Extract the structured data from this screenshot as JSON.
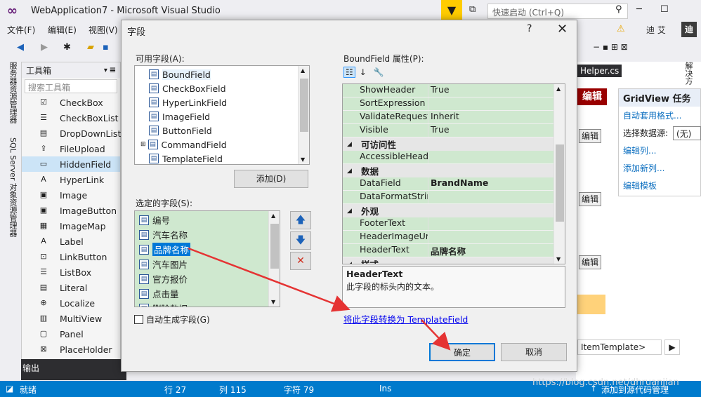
{
  "window": {
    "title": "WebApplication7 - Microsoft Visual Studio",
    "quick_launch": "快速启动 (Ctrl+Q)",
    "user": "迪 艾",
    "user_badge": "迪"
  },
  "menu": [
    "文件(F)",
    "编辑(E)",
    "视图(V)"
  ],
  "left_tabs": [
    "服务器资源管理器",
    "SQL Server 对象资源管理器"
  ],
  "toolbox": {
    "title": "工具箱",
    "search_placeholder": "搜索工具箱",
    "items": [
      {
        "label": "CheckBox",
        "icon": "checkbox-icon"
      },
      {
        "label": "CheckBoxList",
        "icon": "checkboxlist-icon"
      },
      {
        "label": "DropDownList",
        "icon": "dropdown-icon"
      },
      {
        "label": "FileUpload",
        "icon": "fileupload-icon"
      },
      {
        "label": "HiddenField",
        "icon": "hiddenfield-icon"
      },
      {
        "label": "HyperLink",
        "icon": "hyperlink-icon"
      },
      {
        "label": "Image",
        "icon": "image-icon"
      },
      {
        "label": "ImageButton",
        "icon": "imagebutton-icon"
      },
      {
        "label": "ImageMap",
        "icon": "imagemap-icon"
      },
      {
        "label": "Label",
        "icon": "label-icon"
      },
      {
        "label": "LinkButton",
        "icon": "linkbutton-icon"
      },
      {
        "label": "ListBox",
        "icon": "listbox-icon"
      },
      {
        "label": "Literal",
        "icon": "literal-icon"
      },
      {
        "label": "Localize",
        "icon": "localize-icon"
      },
      {
        "label": "MultiView",
        "icon": "multiview-icon"
      },
      {
        "label": "Panel",
        "icon": "panel-icon"
      },
      {
        "label": "PlaceHolder",
        "icon": "placeholder-icon"
      }
    ],
    "selected": "HiddenField"
  },
  "output_label": "输出",
  "status": {
    "ready": "就绪",
    "row": "行 27",
    "col": "列 115",
    "char": "字符 79",
    "ins": "Ins",
    "source_control": "添加到源代码管理"
  },
  "right": {
    "helper_tab": "Helper.cs",
    "edit_header": "编辑",
    "edit_label": "编辑",
    "gridview_tasks": {
      "title": "GridView 任务",
      "auto_format": "自动套用格式...",
      "choose_source_label": "选择数据源:",
      "choose_source_value": "(无)",
      "edit_columns": "编辑列...",
      "add_column": "添加新列...",
      "edit_templates": "编辑模板"
    },
    "item_template": "ItemTemplate>",
    "vertical_label": "解决方"
  },
  "dialog": {
    "title": "字段",
    "help": "?",
    "close": "✕",
    "available_label": "可用字段(A):",
    "available_fields": [
      {
        "label": "BoundField",
        "icon": "boundfield-icon"
      },
      {
        "label": "CheckBoxField",
        "icon": "checkboxfield-icon"
      },
      {
        "label": "HyperLinkField",
        "icon": "hyperlinkfield-icon"
      },
      {
        "label": "ImageField",
        "icon": "imagefield-icon"
      },
      {
        "label": "ButtonField",
        "icon": "buttonfield-icon"
      },
      {
        "label": "CommandField",
        "icon": "commandfield-icon"
      },
      {
        "label": "TemplateField",
        "icon": "templatefield-icon"
      }
    ],
    "add_button": "添加(D)",
    "selected_label": "选定的字段(S):",
    "selected_fields": [
      "编号",
      "汽车名称",
      "品牌名称",
      "汽车图片",
      "官方报价",
      "点击量",
      "删除数据"
    ],
    "selected_current": "品牌名称",
    "auto_generate": "自动生成字段(G)",
    "props_label": "BoundField 属性(P):",
    "properties": [
      {
        "type": "row",
        "name": "ShowHeader",
        "value": "True"
      },
      {
        "type": "row",
        "name": "SortExpression",
        "value": ""
      },
      {
        "type": "row",
        "name": "ValidateRequestMod",
        "value": "Inherit"
      },
      {
        "type": "row",
        "name": "Visible",
        "value": "True"
      },
      {
        "type": "cat",
        "name": "可访问性"
      },
      {
        "type": "row",
        "name": "AccessibleHeaderTe:",
        "value": ""
      },
      {
        "type": "cat",
        "name": "数据"
      },
      {
        "type": "row",
        "name": "DataField",
        "value": "BrandName"
      },
      {
        "type": "row",
        "name": "DataFormatString",
        "value": ""
      },
      {
        "type": "cat",
        "name": "外观"
      },
      {
        "type": "row",
        "name": "FooterText",
        "value": ""
      },
      {
        "type": "row",
        "name": "HeaderImageUrl",
        "value": ""
      },
      {
        "type": "row",
        "name": "HeaderText",
        "value": "品牌名称"
      },
      {
        "type": "cat",
        "name": "样式"
      }
    ],
    "desc_title": "HeaderText",
    "desc_text": "此字段的标头内的文本。",
    "convert_link": "将此字段转换为 TemplateField",
    "ok": "确定",
    "cancel": "取消"
  },
  "watermark": "https://blog.csdn.net/dhruanjian"
}
